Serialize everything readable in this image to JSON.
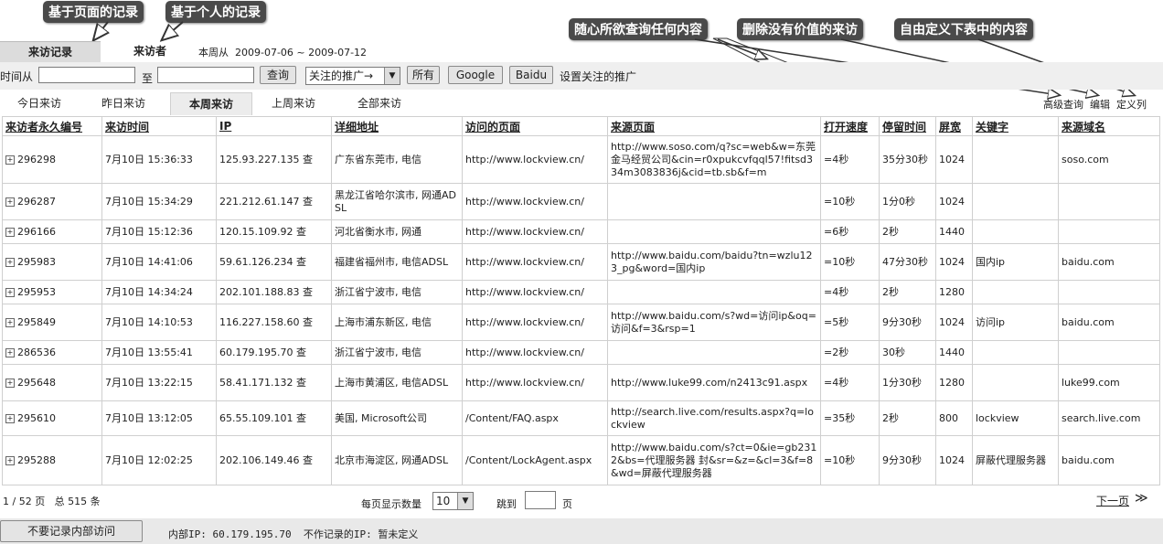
{
  "callouts": {
    "page_records": "基于页面的记录",
    "personal_records": "基于个人的记录",
    "query_any": "随心所欲查询任何内容",
    "delete_visits": "删除没有价值的来访",
    "customize": "自由定义下表中的内容"
  },
  "top_tabs": {
    "records": "来访记录",
    "visitors": "来访者"
  },
  "week_range": "本周从  2009-07-06 ~ 2009-07-12",
  "filter": {
    "time_from_label": "时间从",
    "to_label": "至",
    "query_button": "查询",
    "promo_select": "关注的推广→",
    "all_button": "所有",
    "google_button": "Google",
    "baidu_button": "Baidu",
    "set_promo_link": "设置关注的推广"
  },
  "sub_tabs": [
    "今日来访",
    "昨日来访",
    "本周来访",
    "上周来访",
    "全部来访"
  ],
  "right_links": {
    "advanced": "高级查询",
    "edit": "编辑",
    "define_cols": "定义列"
  },
  "columns": [
    "来访者永久编号",
    "来访时间",
    "IP",
    "详细地址",
    "访问的页面",
    "来源页面",
    "打开速度",
    "停留时间",
    "屏宽",
    "关键字",
    "来源域名"
  ],
  "rows": [
    {
      "id": "296298",
      "time": "7月10日 15:36:33",
      "ip": "125.93.227.135 查",
      "addr": "广东省东莞市, 电信",
      "page": "http://www.lockview.cn/",
      "ref": "http://www.soso.com/q?sc=web&w=东莞金马经贸公司&cin=r0xpukcvfqql57!fitsd334m3083836j&cid=tb.sb&f=m",
      "speed": "=4秒",
      "stay": "35分30秒",
      "width": "1024",
      "kw": "",
      "domain": "soso.com"
    },
    {
      "id": "296287",
      "time": "7月10日 15:34:29",
      "ip": "221.212.61.147 查",
      "addr": "黑龙江省哈尔滨市, 网通ADSL",
      "page": "http://www.lockview.cn/",
      "ref": "",
      "speed": "=10秒",
      "stay": "1分0秒",
      "width": "1024",
      "kw": "",
      "domain": ""
    },
    {
      "id": "296166",
      "time": "7月10日 15:12:36",
      "ip": "120.15.109.92 查",
      "addr": "河北省衡水市, 网通",
      "page": "http://www.lockview.cn/",
      "ref": "",
      "speed": "=6秒",
      "stay": "2秒",
      "width": "1440",
      "kw": "",
      "domain": ""
    },
    {
      "id": "295983",
      "time": "7月10日 14:41:06",
      "ip": "59.61.126.234 查",
      "addr": "福建省福州市, 电信ADSL",
      "page": "http://www.lockview.cn/",
      "ref": "http://www.baidu.com/baidu?tn=wzlu123_pg&word=国内ip",
      "speed": "=10秒",
      "stay": "47分30秒",
      "width": "1024",
      "kw": "国内ip",
      "domain": "baidu.com"
    },
    {
      "id": "295953",
      "time": "7月10日 14:34:24",
      "ip": "202.101.188.83 查",
      "addr": "浙江省宁波市, 电信",
      "page": "http://www.lockview.cn/",
      "ref": "",
      "speed": "=4秒",
      "stay": "2秒",
      "width": "1280",
      "kw": "",
      "domain": ""
    },
    {
      "id": "295849",
      "time": "7月10日 14:10:53",
      "ip": "116.227.158.60 查",
      "addr": "上海市浦东新区, 电信",
      "page": "http://www.lockview.cn/",
      "ref": "http://www.baidu.com/s?wd=访问ip&oq=访问&f=3&rsp=1",
      "speed": "=5秒",
      "stay": "9分30秒",
      "width": "1024",
      "kw": "访问ip",
      "domain": "baidu.com"
    },
    {
      "id": "286536",
      "time": "7月10日 13:55:41",
      "ip": "60.179.195.70 查",
      "addr": "浙江省宁波市, 电信",
      "page": "http://www.lockview.cn/",
      "ref": "",
      "speed": "=2秒",
      "stay": "30秒",
      "width": "1440",
      "kw": "",
      "domain": ""
    },
    {
      "id": "295648",
      "time": "7月10日 13:22:15",
      "ip": "58.41.171.132 查",
      "addr": "上海市黄浦区, 电信ADSL",
      "page": "http://www.lockview.cn/",
      "ref": "http://www.luke99.com/n2413c91.aspx",
      "speed": "=4秒",
      "stay": "1分30秒",
      "width": "1280",
      "kw": "",
      "domain": "luke99.com"
    },
    {
      "id": "295610",
      "time": "7月10日 13:12:05",
      "ip": "65.55.109.101 查",
      "addr": "美国, Microsoft公司",
      "page": "/Content/FAQ.aspx",
      "ref": "http://search.live.com/results.aspx?q=lockview",
      "speed": "=35秒",
      "stay": "2秒",
      "width": "800",
      "kw": "lockview",
      "domain": "search.live.com"
    },
    {
      "id": "295288",
      "time": "7月10日 12:02:25",
      "ip": "202.106.149.46 查",
      "addr": "北京市海淀区, 网通ADSL",
      "page": "/Content/LockAgent.aspx",
      "ref": "http://www.baidu.com/s?ct=0&ie=gb2312&bs=代理服务器 封&sr=&z=&cl=3&f=8&wd=屏蔽代理服务器",
      "speed": "=10秒",
      "stay": "9分30秒",
      "width": "1024",
      "kw": "屏蔽代理服务器",
      "domain": "baidu.com"
    }
  ],
  "pager": {
    "page_info": "1 / 52 页   总 515 条",
    "per_page_label": "每页显示数量",
    "per_page_value": "10",
    "jump_label": "跳到",
    "page_suffix": "页",
    "next_page": "下一页",
    "next_arrows": "≫"
  },
  "bottom": {
    "no_internal_button": "不要记录内部访问",
    "internal_ip_text": "内部IP: 60.179.195.70  不作记录的IP: 暂未定义"
  }
}
